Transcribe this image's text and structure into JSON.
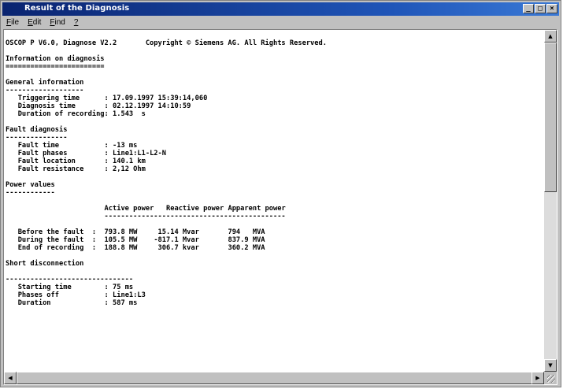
{
  "window": {
    "title": "Result of the Diagnosis",
    "buttons": {
      "minimize": "_",
      "maximize": "□",
      "close": "×"
    }
  },
  "menu": [
    {
      "label": "File",
      "accel": "F",
      "rest": "ile"
    },
    {
      "label": "Edit",
      "accel": "E",
      "rest": "dit"
    },
    {
      "label": "Find",
      "accel": "F",
      "rest": "ind"
    },
    {
      "label": "?",
      "accel": "?",
      "rest": ""
    }
  ],
  "report": {
    "header": "OSCOP P V6.0, Diagnose V2.2       Copyright © Siemens AG. All Rights Reserved.",
    "info_heading": "Information on diagnosis",
    "info_underline": "========================",
    "general": {
      "heading": "General information",
      "underline": "-------------------",
      "rows": [
        {
          "label": "Triggering time",
          "value": "17.09.1997 15:39:14,060"
        },
        {
          "label": "Diagnosis time",
          "value": "02.12.1997 14:10:59"
        },
        {
          "label": "Duration of recording",
          "value": "1.543  s"
        }
      ]
    },
    "fault": {
      "heading": "Fault diagnosis",
      "underline": "---------------",
      "rows": [
        {
          "label": "Fault time",
          "value": "-13 ms"
        },
        {
          "label": "Fault phases",
          "value": "Line1:L1-L2-N"
        },
        {
          "label": "Fault location",
          "value": "140.1 km"
        },
        {
          "label": "Fault resistance",
          "value": "2,12 Ohm"
        }
      ]
    },
    "power": {
      "heading": "Power values",
      "underline": "------------",
      "columns": [
        "Active power",
        "Reactive power",
        "Apparent power"
      ],
      "rows": [
        {
          "label": "Before the fault",
          "active": "793.8 MW",
          "reactive": "15.14 Mvar",
          "apparent": "794   MVA"
        },
        {
          "label": "During the fault",
          "active": "105.5 MW",
          "reactive": "-817.1  Mvar",
          "apparent": "837.9 MVA"
        },
        {
          "label": "End of recording",
          "active": "188.8 MW",
          "reactive": "306.7  kvar",
          "apparent": "360.2 MVA"
        }
      ]
    },
    "short": {
      "heading": "Short disconnection",
      "underline": "-------------------------------",
      "rows": [
        {
          "label": "Starting time",
          "value": "75 ms"
        },
        {
          "label": "Phases off",
          "value": "Line1:L3"
        },
        {
          "label": "Duration",
          "value": "587 ms"
        }
      ]
    }
  },
  "scroll": {
    "vertical_position": 0.0,
    "horizontal_position": 0.0
  }
}
